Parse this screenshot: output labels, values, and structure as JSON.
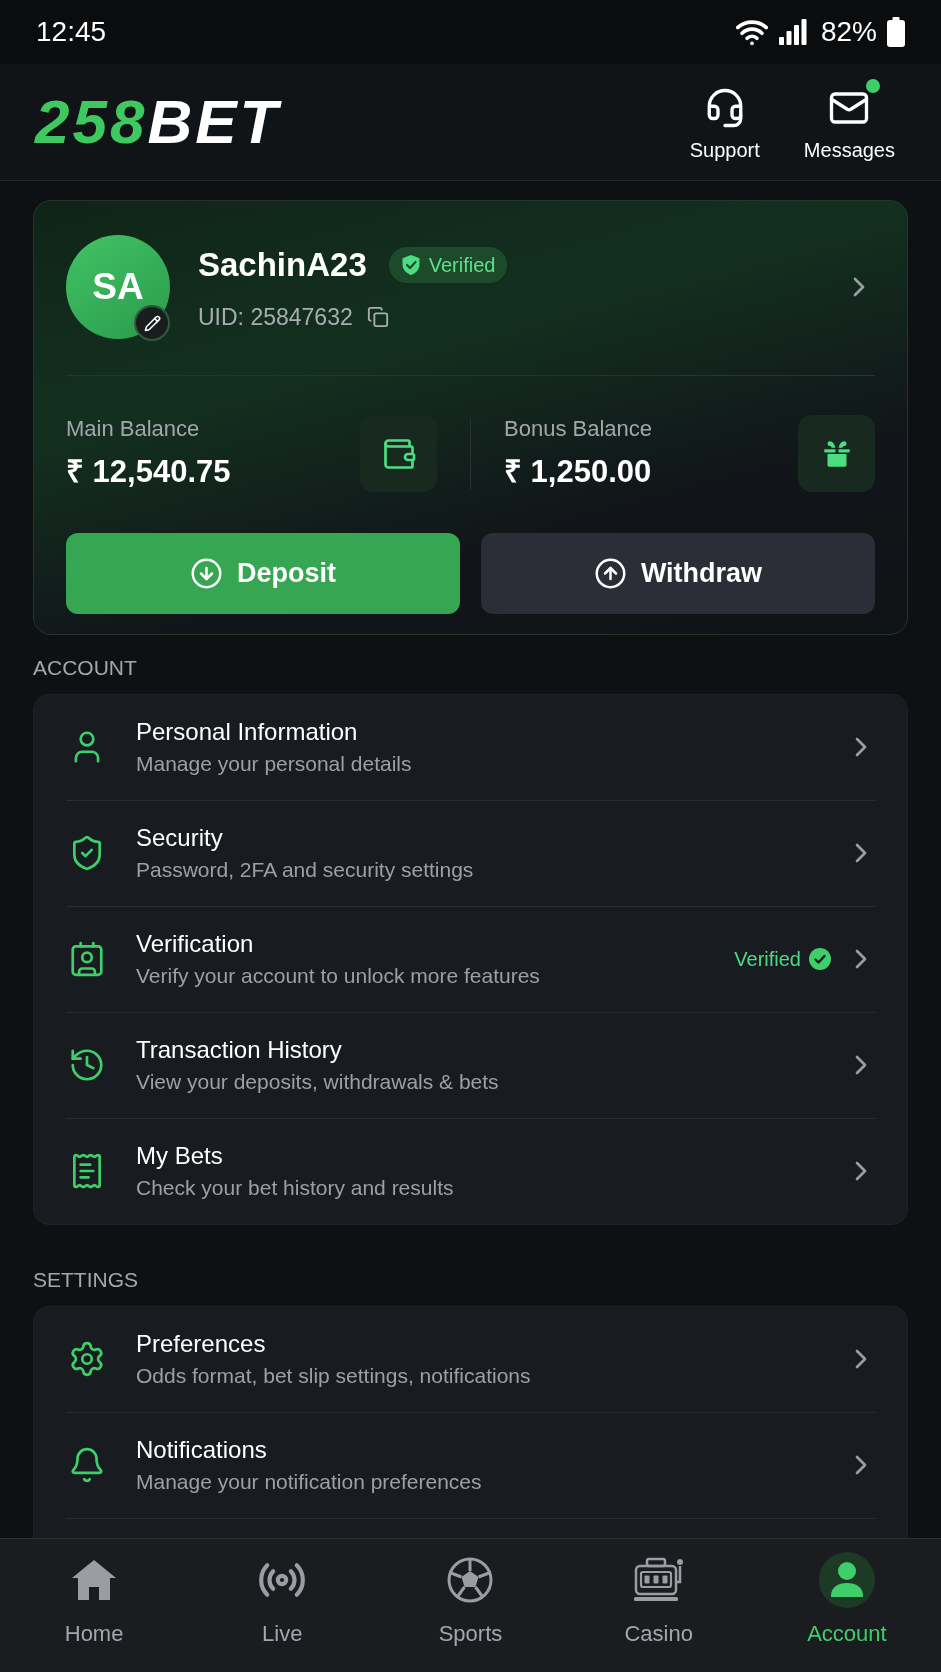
{
  "status_bar": {
    "time": "12:45",
    "battery": "82%"
  },
  "header": {
    "logo": {
      "accent": "258",
      "text": "BET"
    },
    "actions": [
      {
        "kind": "support",
        "label": "Support",
        "has_badge": false
      },
      {
        "kind": "messages",
        "label": "Messages",
        "has_badge": true
      }
    ]
  },
  "profile": {
    "initials": "SA",
    "username": "SachinA23",
    "badge": "Verified",
    "uid": "UID: 25847632",
    "balances": [
      {
        "kind": "main",
        "label": "Main Balance",
        "amount": "₹ 12,540.75"
      },
      {
        "kind": "bonus",
        "label": "Bonus Balance",
        "amount": "₹ 1,250.00"
      }
    ],
    "buttons": [
      {
        "kind": "deposit",
        "label": "Deposit"
      },
      {
        "kind": "withdraw",
        "label": "Withdraw"
      }
    ]
  },
  "sections": [
    {
      "title": "ACCOUNT",
      "items": [
        {
          "kind": "personal",
          "title": "Personal Information",
          "subtitle": "Manage your personal details"
        },
        {
          "kind": "security",
          "title": "Security",
          "subtitle": "Password, 2FA and security settings"
        },
        {
          "kind": "verification",
          "title": "Verification",
          "subtitle": "Verify your account to unlock more features",
          "status": "Verified"
        },
        {
          "kind": "history",
          "title": "Transaction History",
          "subtitle": "View your deposits, withdrawals & bets"
        },
        {
          "kind": "bets",
          "title": "My Bets",
          "subtitle": "Check your bet history and results"
        }
      ]
    },
    {
      "title": "SETTINGS",
      "items": [
        {
          "kind": "preferences",
          "title": "Preferences",
          "subtitle": "Odds format, bet slip settings, notifications"
        },
        {
          "kind": "notifications",
          "title": "Notifications",
          "subtitle": "Manage your notification preferences"
        }
      ]
    }
  ],
  "bottom_nav": [
    {
      "kind": "home",
      "label": "Home",
      "selected": false
    },
    {
      "kind": "live",
      "label": "Live",
      "selected": false
    },
    {
      "kind": "sports",
      "label": "Sports",
      "selected": false
    },
    {
      "kind": "casino",
      "label": "Casino",
      "selected": false
    },
    {
      "kind": "account",
      "label": "Account",
      "selected": true
    }
  ]
}
